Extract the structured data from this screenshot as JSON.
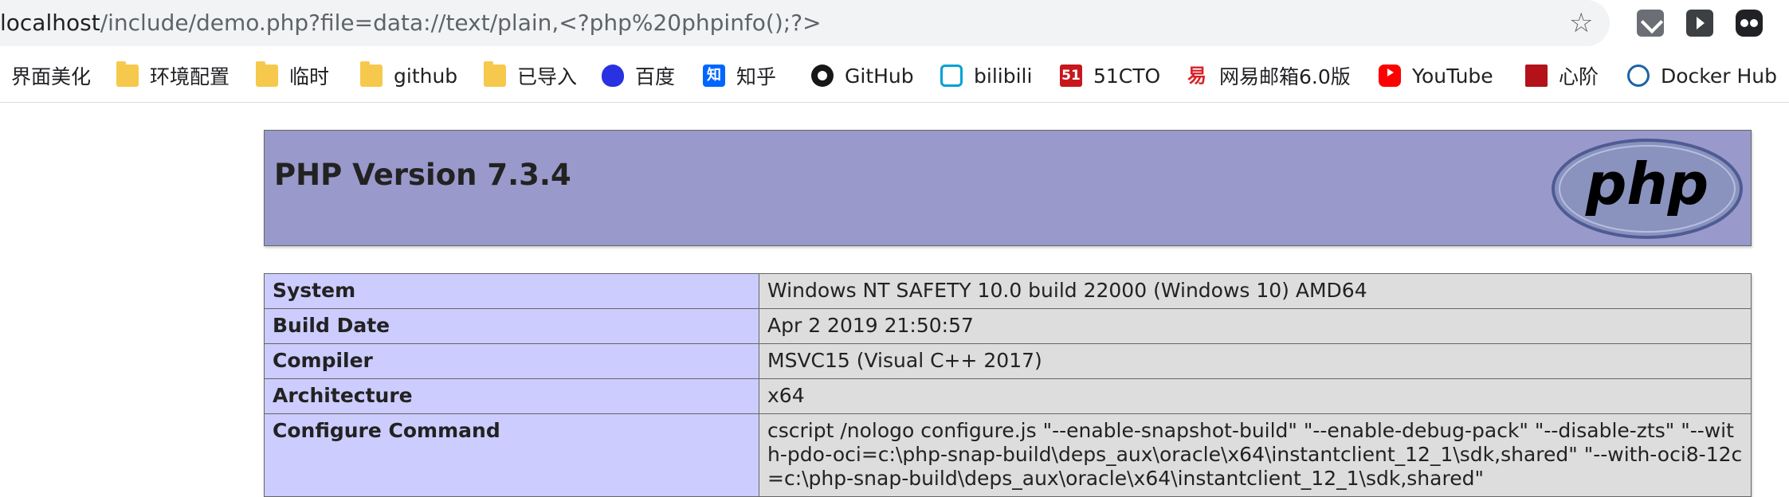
{
  "address_bar": {
    "url_host": "localhost",
    "url_rest": "/include/demo.php?file=data://text/plain,<?php%20phpinfo();?>"
  },
  "bookmarks": [
    {
      "label": "界面美化",
      "icon": "none"
    },
    {
      "label": "环境配置",
      "icon": "folder-icon"
    },
    {
      "label": "临时",
      "icon": "folder-icon"
    },
    {
      "label": "github",
      "icon": "folder-icon"
    },
    {
      "label": "已导入",
      "icon": "folder-icon"
    },
    {
      "label": "百度",
      "icon": "baidu-icon"
    },
    {
      "label": "知乎",
      "icon": "zhihu-icon",
      "glyph": "知"
    },
    {
      "label": "GitHub",
      "icon": "github-icon"
    },
    {
      "label": "bilibili",
      "icon": "bilibili-icon"
    },
    {
      "label": "51CTO",
      "icon": "51cto-icon",
      "glyph": "51"
    },
    {
      "label": "网易邮箱6.0版",
      "icon": "netease-mail-icon",
      "glyph": "易"
    },
    {
      "label": "YouTube",
      "icon": "youtube-icon"
    },
    {
      "label": "心阶",
      "icon": "xinjie-icon"
    },
    {
      "label": "Docker Hub",
      "icon": "docker-icon"
    }
  ],
  "phpinfo": {
    "title": "PHP Version 7.3.4",
    "logo_text": "php",
    "rows": [
      {
        "key": "System",
        "value": "Windows NT SAFETY 10.0 build 22000 (Windows 10) AMD64"
      },
      {
        "key": "Build Date",
        "value": "Apr 2 2019 21:50:57"
      },
      {
        "key": "Compiler",
        "value": "MSVC15 (Visual C++ 2017)"
      },
      {
        "key": "Architecture",
        "value": "x64"
      },
      {
        "key": "Configure Command",
        "value": "cscript /nologo configure.js \"--enable-snapshot-build\" \"--enable-debug-pack\" \"--disable-zts\" \"--with-pdo-oci=c:\\php-snap-build\\deps_aux\\oracle\\x64\\instantclient_12_1\\sdk,shared\" \"--with-oci8-12c=c:\\php-snap-build\\deps_aux\\oracle\\x64\\instantclient_12_1\\sdk,shared\""
      }
    ]
  },
  "colors": {
    "header_bg": "#9999cc",
    "key_cell_bg": "#ccccff",
    "value_cell_bg": "#dddddd"
  }
}
